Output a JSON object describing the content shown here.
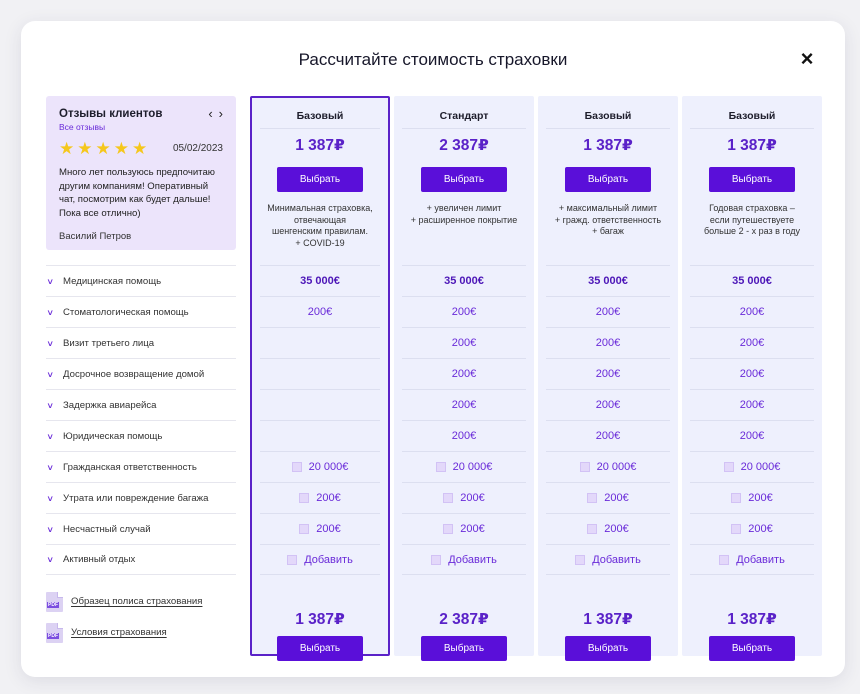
{
  "title": "Рассчитайте стоимость страховки",
  "close_icon": "×",
  "reviews": {
    "title": "Отзывы клиентов",
    "all_link": "Все отзывы",
    "prev": "‹",
    "next": "›",
    "rating": 5,
    "date": "05/02/2023",
    "text": "Много лет пользуюсь предпочитаю другим компаниям! Оперативный чат, посмотрим как будет дальше! Пока все отлично)",
    "author": "Василий Петров"
  },
  "features": [
    "Медицинская помощь",
    "Стоматологическая помощь",
    "Визит третьего лица",
    "Досрочное возвращение домой",
    "Задержка авиарейса",
    "Юридическая помощь",
    "Гражданская ответственность",
    "Утрата или повреждение багажа",
    "Несчастный случай",
    "Активный отдых"
  ],
  "docs": [
    {
      "label": "Образец полиса страхования",
      "tag": "PDF"
    },
    {
      "label": "Условия страхования",
      "tag": "PDF"
    }
  ],
  "plans": [
    {
      "name": "Базовый",
      "price": "1 387₽",
      "button": "Выбрать",
      "selected": true,
      "desc": [
        "Минимальная страховка,",
        "отвечающая",
        "шенгенским правилам.",
        "+ COVID-19"
      ],
      "cells": [
        {
          "text": "35 000€",
          "bold": true
        },
        {
          "text": "200€"
        },
        {
          "text": ""
        },
        {
          "text": ""
        },
        {
          "text": ""
        },
        {
          "text": ""
        },
        {
          "text": "20 000€",
          "checkbox": true
        },
        {
          "text": "200€",
          "checkbox": true
        },
        {
          "text": "200€",
          "checkbox": true
        },
        {
          "text": "Добавить",
          "checkbox": true
        }
      ]
    },
    {
      "name": "Стандарт",
      "price": "2 387₽",
      "button": "Выбрать",
      "selected": false,
      "desc": [
        "+ увеличен лимит",
        "+ расширенное покрытие"
      ],
      "cells": [
        {
          "text": "35 000€",
          "bold": true
        },
        {
          "text": "200€"
        },
        {
          "text": "200€"
        },
        {
          "text": "200€"
        },
        {
          "text": "200€"
        },
        {
          "text": "200€"
        },
        {
          "text": "20 000€",
          "checkbox": true
        },
        {
          "text": "200€",
          "checkbox": true
        },
        {
          "text": "200€",
          "checkbox": true
        },
        {
          "text": "Добавить",
          "checkbox": true
        }
      ]
    },
    {
      "name": "Базовый",
      "price": "1 387₽",
      "button": "Выбрать",
      "selected": false,
      "desc": [
        "+ максимальный лимит",
        "+ гражд. ответственность",
        "+ багаж"
      ],
      "cells": [
        {
          "text": "35 000€",
          "bold": true
        },
        {
          "text": "200€"
        },
        {
          "text": "200€"
        },
        {
          "text": "200€"
        },
        {
          "text": "200€"
        },
        {
          "text": "200€"
        },
        {
          "text": "20 000€",
          "checkbox": true
        },
        {
          "text": "200€",
          "checkbox": true
        },
        {
          "text": "200€",
          "checkbox": true
        },
        {
          "text": "Добавить",
          "checkbox": true
        }
      ]
    },
    {
      "name": "Базовый",
      "price": "1 387₽",
      "button": "Выбрать",
      "selected": false,
      "desc": [
        "Годовая страховка –",
        "если путешествуете",
        "больше 2 - х раз в году"
      ],
      "cells": [
        {
          "text": "35 000€",
          "bold": true
        },
        {
          "text": "200€"
        },
        {
          "text": "200€"
        },
        {
          "text": "200€"
        },
        {
          "text": "200€"
        },
        {
          "text": "200€"
        },
        {
          "text": "20 000€",
          "checkbox": true
        },
        {
          "text": "200€",
          "checkbox": true
        },
        {
          "text": "200€",
          "checkbox": true
        },
        {
          "text": "Добавить",
          "checkbox": true
        }
      ]
    }
  ],
  "colors": {
    "accent": "#5a0fd9",
    "price": "#5a22c8",
    "star": "#f5c71c",
    "review_bg": "#ece4fb",
    "plan_bg": "#eef0fd"
  }
}
